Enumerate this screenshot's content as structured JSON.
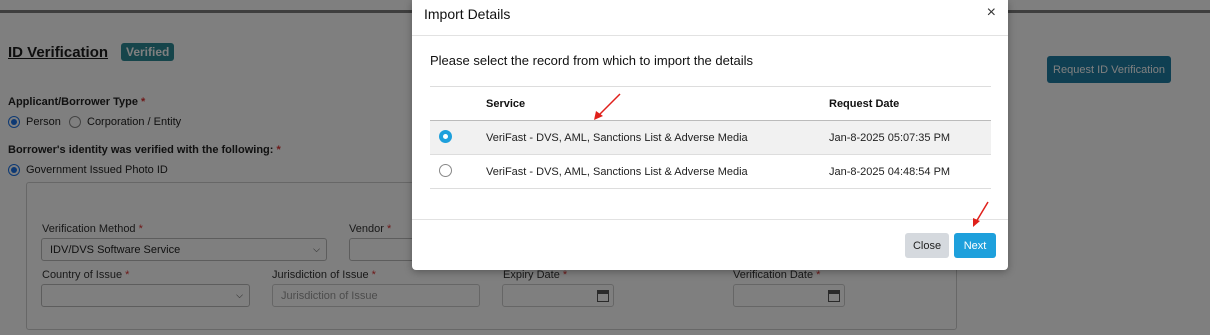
{
  "page": {
    "title": "ID Verification",
    "badge": "Verified",
    "request_button": "Request ID Verification",
    "applicant_type_label": "Applicant/Borrower Type",
    "required_mark": "*",
    "applicant_options": [
      "Person",
      "Corporation / Entity"
    ],
    "applicant_selected": "Person",
    "identity_label": "Borrower's identity was verified with the following:",
    "identity_option": "Government Issued Photo ID",
    "form": {
      "verification_method_label": "Verification Method",
      "verification_method_value": "IDV/DVS Software Service",
      "vendor_label": "Vendor",
      "country_label": "Country of Issue",
      "country_value": "",
      "jurisdiction_label": "Jurisdiction of Issue",
      "jurisdiction_placeholder": "Jurisdiction of Issue",
      "expiry_label": "Expiry Date",
      "verification_date_label": "Verification Date"
    }
  },
  "modal": {
    "title": "Import Details",
    "close_icon": "×",
    "subtitle": "Please select the record from which to import the details",
    "columns": [
      "Service",
      "Request Date"
    ],
    "rows": [
      {
        "service": "VeriFast - DVS, AML, Sanctions List & Adverse Media",
        "request_date": "Jan-8-2025 05:07:35 PM",
        "selected": true
      },
      {
        "service": "VeriFast - DVS, AML, Sanctions List & Adverse Media",
        "request_date": "Jan-8-2025 04:48:54 PM",
        "selected": false
      }
    ],
    "buttons": {
      "close": "Close",
      "next": "Next"
    }
  },
  "colors": {
    "accent": "#1ea0dc",
    "annotation_arrow": "#e0201b",
    "badge": "#2d8a97"
  }
}
